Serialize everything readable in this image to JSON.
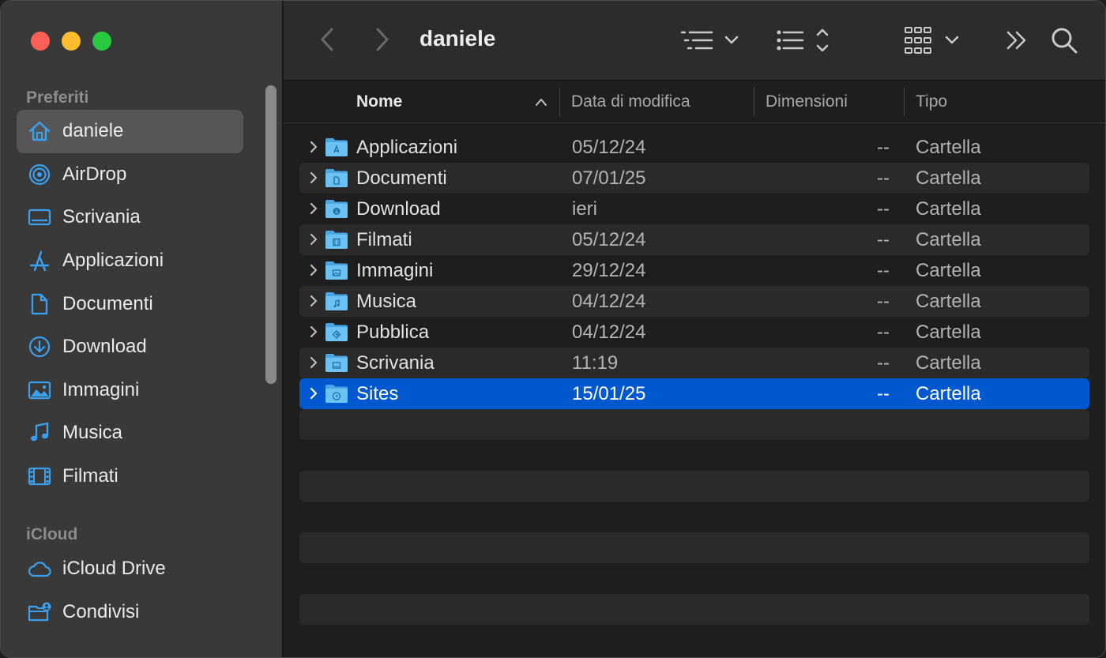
{
  "window": {
    "title": "daniele"
  },
  "sidebar": {
    "favorites_title": "Preferiti",
    "favorites": [
      {
        "label": "daniele",
        "icon": "home-icon",
        "active": true
      },
      {
        "label": "AirDrop",
        "icon": "airdrop-icon"
      },
      {
        "label": "Scrivania",
        "icon": "desktop-icon"
      },
      {
        "label": "Applicazioni",
        "icon": "applications-icon"
      },
      {
        "label": "Documenti",
        "icon": "document-icon"
      },
      {
        "label": "Download",
        "icon": "download-icon"
      },
      {
        "label": "Immagini",
        "icon": "photo-icon"
      },
      {
        "label": "Musica",
        "icon": "music-icon"
      },
      {
        "label": "Filmati",
        "icon": "film-icon"
      }
    ],
    "icloud_title": "iCloud",
    "icloud": [
      {
        "label": "iCloud Drive",
        "icon": "cloud-icon"
      },
      {
        "label": "Condivisi",
        "icon": "shared-folder-icon"
      }
    ]
  },
  "columns": {
    "name": "Nome",
    "date": "Data di modifica",
    "size": "Dimensioni",
    "kind": "Tipo"
  },
  "files": [
    {
      "name": "Applicazioni",
      "date": "05/12/24",
      "size": "--",
      "kind": "Cartella",
      "glyph": "applications"
    },
    {
      "name": "Documenti",
      "date": "07/01/25",
      "size": "--",
      "kind": "Cartella",
      "glyph": "document"
    },
    {
      "name": "Download",
      "date": "ieri",
      "size": "--",
      "kind": "Cartella",
      "glyph": "download"
    },
    {
      "name": "Filmati",
      "date": "05/12/24",
      "size": "--",
      "kind": "Cartella",
      "glyph": "film"
    },
    {
      "name": "Immagini",
      "date": "29/12/24",
      "size": "--",
      "kind": "Cartella",
      "glyph": "photo"
    },
    {
      "name": "Musica",
      "date": "04/12/24",
      "size": "--",
      "kind": "Cartella",
      "glyph": "music"
    },
    {
      "name": "Pubblica",
      "date": "04/12/24",
      "size": "--",
      "kind": "Cartella",
      "glyph": "public"
    },
    {
      "name": "Scrivania",
      "date": "11:19",
      "size": "--",
      "kind": "Cartella",
      "glyph": "desktop"
    },
    {
      "name": "Sites",
      "date": "15/01/25",
      "size": "--",
      "kind": "Cartella",
      "glyph": "compass",
      "selected": true
    }
  ],
  "colors": {
    "accent": "#0058d0",
    "icon_blue": "#3aa0f0",
    "folder_blue": "#5ab4ec"
  }
}
